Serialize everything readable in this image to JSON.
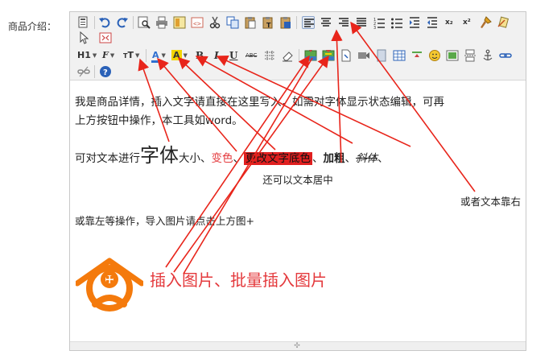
{
  "form": {
    "label": "商品介绍："
  },
  "toolbar": {
    "paragraph_label": "H1",
    "font_family_label": "F",
    "font_size_label": "T",
    "font_color_label": "A",
    "bg_color_label": "A",
    "bold_label": "B",
    "italic_label": "I",
    "underline_label": "U",
    "strike_label": "ABC",
    "superscript_label": "x²",
    "subscript_label": "x₂",
    "active_button": "align-left",
    "colors": {
      "font_color_bar": "#2f6fd0",
      "bg_color_bar": "#f2d400",
      "separator": "#c8c8c8"
    }
  },
  "content": {
    "para1_line1": "我是商品详情，插入文字请直接在这里写入，如需对字体显示状态编辑，可再",
    "para1_line2": "上方按钮中操作，本工具如word。",
    "line2_prefix": "可对文本进行",
    "line2_big": "字体",
    "line2_size": "大小、",
    "line2_color": "变色",
    "line2_sep1": "、",
    "line2_bg": "更改文字底色",
    "line2_sep2": "、",
    "line2_bold": "加粗",
    "line2_sep3": "、",
    "line2_italic": "斜体",
    "line2_sep4": "、",
    "center_text": "还可以文本居中",
    "right_text": "或者文本靠右",
    "left_text": "或靠左等操作，导入图片请点击上方图+",
    "image_caption": "插入图片、批量插入图片",
    "colors": {
      "red_text": "#e4393c",
      "highlight": "#e02020",
      "logo_orange": "#f47a0c",
      "annotation_arrow": "#e8251b"
    }
  },
  "resize_handle": "resize-grip-icon"
}
